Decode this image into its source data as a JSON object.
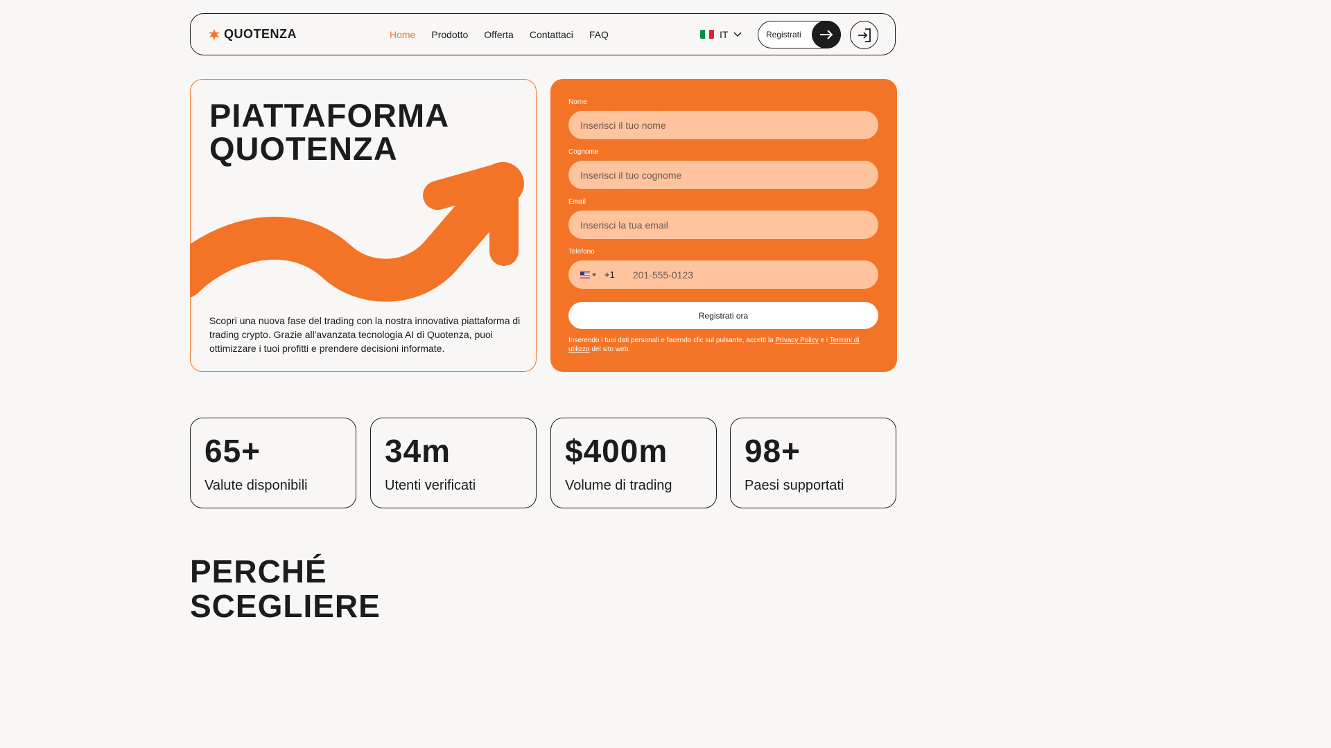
{
  "header": {
    "logo_text": "QUOTENZA",
    "nav": [
      {
        "label": "Home",
        "active": true
      },
      {
        "label": "Prodotto"
      },
      {
        "label": "Offerta"
      },
      {
        "label": "Contattaci"
      },
      {
        "label": "FAQ"
      }
    ],
    "lang": "IT",
    "register_label": "Registrati"
  },
  "hero": {
    "title_line1": "PIATTAFORMA",
    "title_line2": "QUOTENZA",
    "description": "Scopri una nuova fase del trading con la nostra innovativa piattaforma di trading crypto. Grazie all'avanzata tecnologia AI di Quotenza, puoi ottimizzare i tuoi profitti e prendere decisioni informate."
  },
  "form": {
    "name_label": "Nome",
    "name_placeholder": "Inserisci il tuo nome",
    "surname_label": "Cognome",
    "surname_placeholder": "Inserisci il tuo cognome",
    "email_label": "Email",
    "email_placeholder": "Inserisci la tua email",
    "phone_label": "Telefono",
    "phone_code": "+1",
    "phone_placeholder": "201-555-0123",
    "submit_label": "Registrati ora",
    "legal_prefix": "Inserendo i tuoi dati personali e facendo clic sul pulsante, accetti la ",
    "privacy_link": "Privacy Policy",
    "legal_middle": " e i ",
    "terms_link": "Termini di utilizzo",
    "legal_suffix": " del sito web."
  },
  "stats": [
    {
      "value": "65+",
      "label": "Valute disponibili"
    },
    {
      "value": "34m",
      "label": "Utenti verificati"
    },
    {
      "value": "$400m",
      "label": "Volume di trading"
    },
    {
      "value": "98+",
      "label": "Paesi supportati"
    }
  ],
  "section": {
    "title_line1": "PERCHÉ",
    "title_line2": "SCEGLIERE"
  },
  "colors": {
    "accent": "#f37427",
    "input_bg": "#ffc49e",
    "dark": "#1c1c1c",
    "background": "#f8f7f5"
  }
}
